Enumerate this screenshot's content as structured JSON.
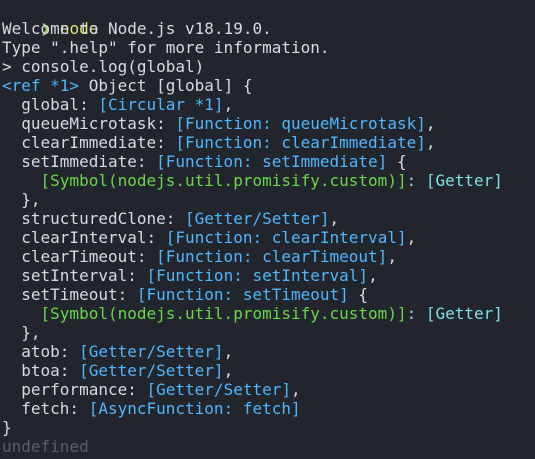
{
  "prompt": {
    "arrow": "❯",
    "command": "node"
  },
  "banner": [
    "Welcome to Node.js v18.19.0.",
    "Type \".help\" for more information."
  ],
  "repl_input": {
    "prompt": ">",
    "code": "console.log(global)"
  },
  "output": {
    "ref_tag": "<ref *1>",
    "object_label": "Object [global] {",
    "lines": [
      {
        "indent": "  ",
        "key": "global: ",
        "value": "[Circular *1]",
        "tail": ","
      },
      {
        "indent": "  ",
        "key": "queueMicrotask: ",
        "value": "[Function: queueMicrotask]",
        "tail": ","
      },
      {
        "indent": "  ",
        "key": "clearImmediate: ",
        "value": "[Function: clearImmediate]",
        "tail": ","
      },
      {
        "indent": "  ",
        "key": "setImmediate: ",
        "value": "[Function: setImmediate]",
        "tail": " {"
      },
      {
        "indent": "    ",
        "key": "",
        "value": "[Symbol(nodejs.util.promisify.custom)]",
        "tail": ": [Getter]",
        "symbol": true
      },
      {
        "indent": "  ",
        "key": "},",
        "value": "",
        "tail": ""
      },
      {
        "indent": "  ",
        "key": "structuredClone: ",
        "value": "[Getter/Setter]",
        "tail": ","
      },
      {
        "indent": "  ",
        "key": "clearInterval: ",
        "value": "[Function: clearInterval]",
        "tail": ","
      },
      {
        "indent": "  ",
        "key": "clearTimeout: ",
        "value": "[Function: clearTimeout]",
        "tail": ","
      },
      {
        "indent": "  ",
        "key": "setInterval: ",
        "value": "[Function: setInterval]",
        "tail": ","
      },
      {
        "indent": "  ",
        "key": "setTimeout: ",
        "value": "[Function: setTimeout]",
        "tail": " {"
      },
      {
        "indent": "    ",
        "key": "",
        "value": "[Symbol(nodejs.util.promisify.custom)]",
        "tail": ": [Getter]",
        "symbol": true
      },
      {
        "indent": "  ",
        "key": "},",
        "value": "",
        "tail": ""
      },
      {
        "indent": "  ",
        "key": "atob: ",
        "value": "[Getter/Setter]",
        "tail": ","
      },
      {
        "indent": "  ",
        "key": "btoa: ",
        "value": "[Getter/Setter]",
        "tail": ","
      },
      {
        "indent": "  ",
        "key": "performance: ",
        "value": "[Getter/Setter]",
        "tail": ","
      },
      {
        "indent": "  ",
        "key": "fetch: ",
        "value": "[AsyncFunction: fetch]",
        "tail": ""
      }
    ],
    "close": "}",
    "result": "undefined"
  },
  "colors": {
    "background": "#22252b",
    "text": "#d8dce2",
    "prompt_arrow": "#9bd14f",
    "command": "#e3e36a",
    "value_blue": "#4fb7ff",
    "symbol_green": "#6ad64d",
    "getter_cyan": "#7ee0e6",
    "dim": "#5a5f69"
  }
}
